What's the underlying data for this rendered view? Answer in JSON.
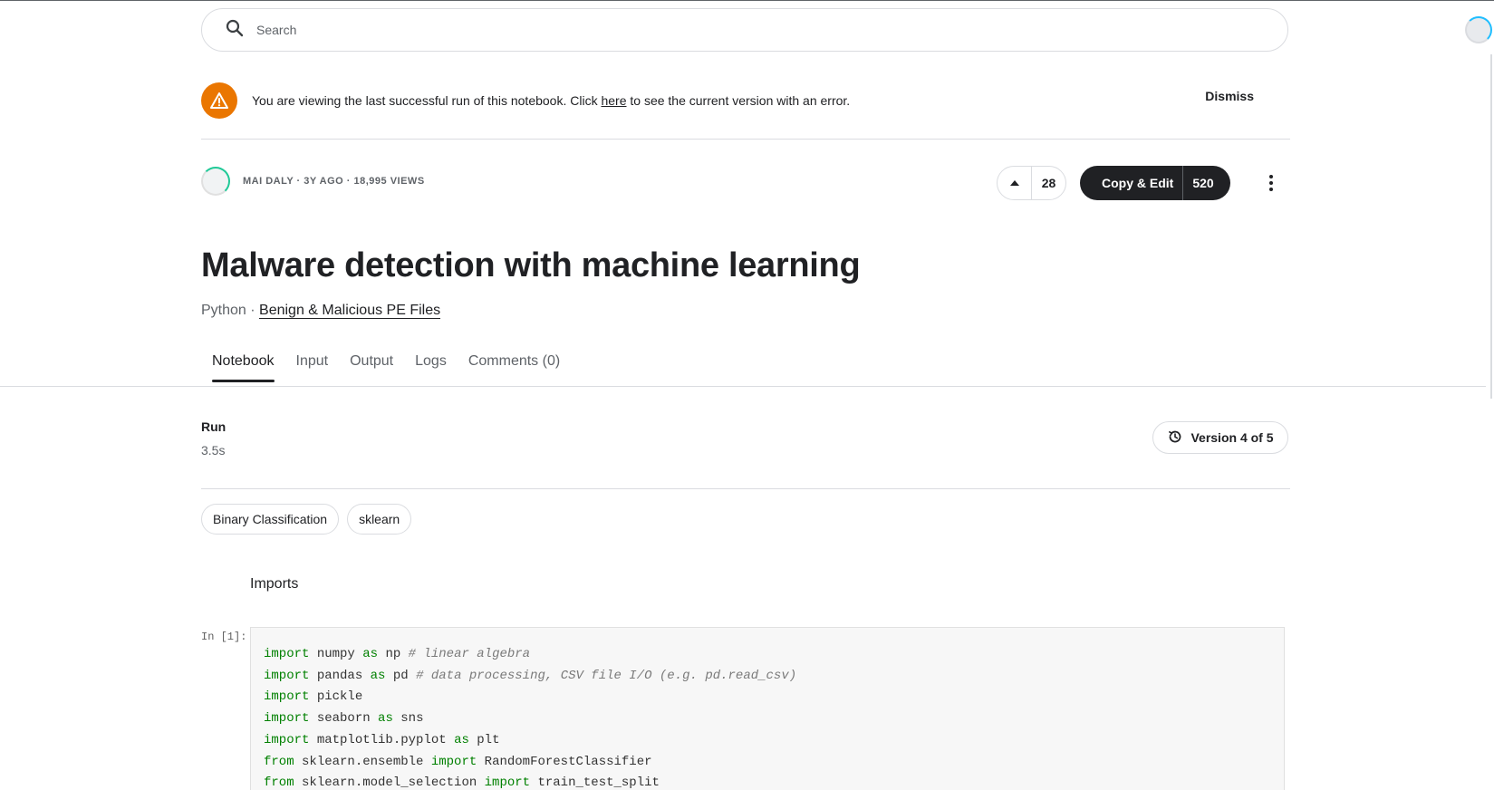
{
  "search": {
    "placeholder": "Search"
  },
  "banner": {
    "text_before": "You are viewing the last successful run of this notebook. Click ",
    "link": "here",
    "text_after": " to see the current version with an error.",
    "dismiss": "Dismiss"
  },
  "meta": {
    "author": "MAI DALY",
    "age": "3Y AGO",
    "views": "18,995 VIEWS",
    "separator": " · "
  },
  "actions": {
    "upvotes": "28",
    "copy_edit_label": "Copy & Edit",
    "copy_edit_count": "520"
  },
  "notebook": {
    "title": "Malware detection with machine learning",
    "language": "Python",
    "separator": " · ",
    "dataset": "Benign & Malicious PE Files"
  },
  "tabs": [
    "Notebook",
    "Input",
    "Output",
    "Logs",
    "Comments (0)"
  ],
  "run": {
    "label": "Run",
    "time": "3.5s",
    "version": "Version 4 of 5"
  },
  "tags": [
    "Binary Classification",
    "sklearn"
  ],
  "section_heading": "Imports",
  "cell": {
    "prompt": "In [1]:",
    "lines": [
      {
        "kw": "import",
        "rest": " numpy ",
        "kw2": "as",
        "rest2": " np ",
        "comment": "# linear algebra"
      },
      {
        "kw": "import",
        "rest": " pandas ",
        "kw2": "as",
        "rest2": " pd ",
        "comment": "# data processing, CSV file I/O (e.g. pd.read_csv)"
      },
      {
        "kw": "import",
        "rest": " pickle",
        "kw2": "",
        "rest2": "",
        "comment": ""
      },
      {
        "kw": "import",
        "rest": " seaborn ",
        "kw2": "as",
        "rest2": " sns",
        "comment": ""
      },
      {
        "kw": "import",
        "rest": " matplotlib.pyplot ",
        "kw2": "as",
        "rest2": " plt",
        "comment": ""
      },
      {
        "kw": "from",
        "rest": " sklearn.ensemble ",
        "kw2": "import",
        "rest2": " RandomForestClassifier",
        "comment": ""
      },
      {
        "kw": "from",
        "rest": " sklearn.model_selection ",
        "kw2": "import",
        "rest2": " train_test_split",
        "comment": ""
      }
    ]
  },
  "colors": {
    "warning": "#ea7600",
    "primary_dark": "#202124",
    "keyword": "#008000",
    "comment": "#7a7a7a"
  },
  "icons": {
    "search": "search-icon",
    "warning": "warning-icon",
    "upvote": "upvote-arrow-icon",
    "more": "more-vertical-icon",
    "history": "history-icon"
  }
}
